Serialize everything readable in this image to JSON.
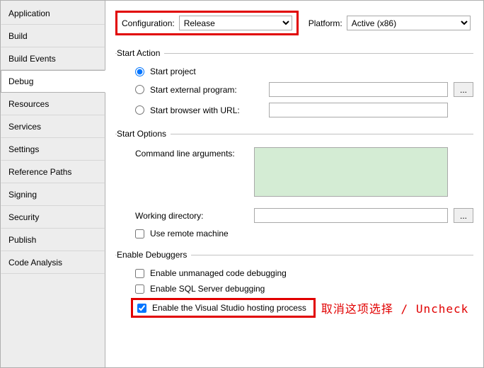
{
  "sidebar": {
    "items": [
      {
        "label": "Application"
      },
      {
        "label": "Build"
      },
      {
        "label": "Build Events"
      },
      {
        "label": "Debug"
      },
      {
        "label": "Resources"
      },
      {
        "label": "Services"
      },
      {
        "label": "Settings"
      },
      {
        "label": "Reference Paths"
      },
      {
        "label": "Signing"
      },
      {
        "label": "Security"
      },
      {
        "label": "Publish"
      },
      {
        "label": "Code Analysis"
      }
    ],
    "active_index": 3
  },
  "config": {
    "label": "Configuration:",
    "value": "Release",
    "platform_label": "Platform:",
    "platform_value": "Active (x86)"
  },
  "start_action": {
    "legend": "Start Action",
    "start_project": "Start project",
    "start_external": "Start external program:",
    "start_browser": "Start browser with URL:",
    "browse": "..."
  },
  "start_options": {
    "legend": "Start Options",
    "cmd_args_label": "Command line arguments:",
    "cmd_args_value": "",
    "working_dir_label": "Working directory:",
    "working_dir_value": "",
    "browse": "...",
    "use_remote": "Use remote machine"
  },
  "enable_debuggers": {
    "legend": "Enable Debuggers",
    "unmanaged": "Enable unmanaged code debugging",
    "sql": "Enable SQL Server debugging",
    "vshost": "Enable the Visual Studio hosting process"
  },
  "annotation": "取消这项选择 / Uncheck"
}
